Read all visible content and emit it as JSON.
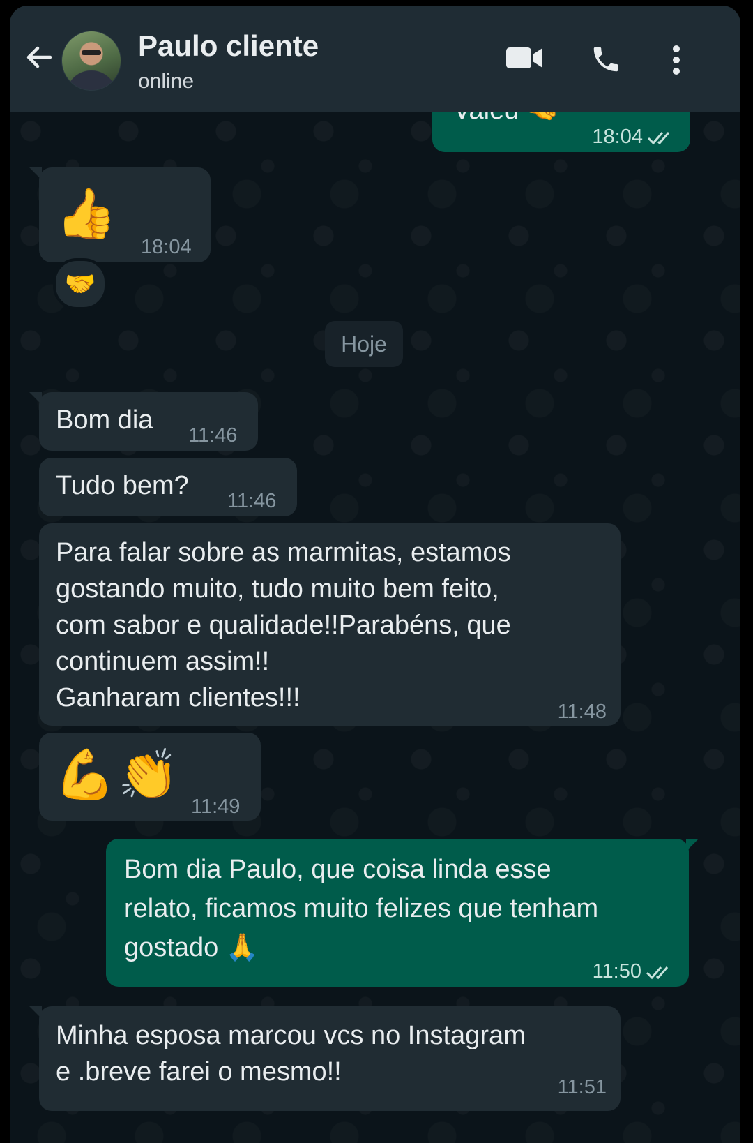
{
  "header": {
    "contact_name": "Paulo cliente",
    "status": "online"
  },
  "colors": {
    "header_bg": "#1f2c34",
    "chat_bg": "#0b141a",
    "incoming_bubble": "#202c33",
    "outgoing_bubble": "#005c4b",
    "read_tick": "#53bdeb"
  },
  "icons": [
    "back-arrow-icon",
    "video-call-icon",
    "phone-call-icon",
    "more-options-icon",
    "read-receipt-icon"
  ],
  "messages": {
    "m0": {
      "text": "Valeu 🤜",
      "time": "18:04"
    },
    "m1": {
      "emoji": "👍",
      "time": "18:04",
      "reaction": "🤝"
    },
    "day": "Hoje",
    "m2": {
      "text": "Bom dia",
      "time": "11:46"
    },
    "m3": {
      "text": "Tudo bem?",
      "time": "11:46"
    },
    "m4": {
      "text": "Para falar sobre as marmitas, estamos\ngostando muito, tudo muito bem feito,\ncom sabor e qualidade!!Parabéns, que\ncontinuem assim!!\nGanharam clientes!!!",
      "time": "11:48"
    },
    "m5": {
      "emoji": "💪👏",
      "time": "11:49"
    },
    "m6": {
      "text": "Bom dia Paulo,  que coisa linda esse\nrelato,  ficamos muito felizes que tenham\ngostado 🙏",
      "time": "11:50"
    },
    "m7": {
      "text": "Minha esposa marcou vcs no Instagram\ne .breve farei o mesmo!!",
      "time": "11:51"
    }
  }
}
